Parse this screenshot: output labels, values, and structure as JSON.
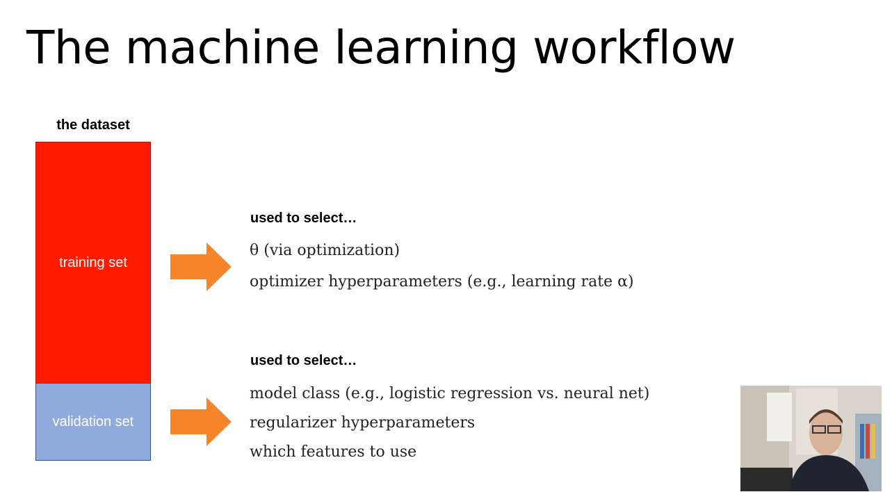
{
  "title": "The machine learning workflow",
  "dataset": {
    "label": "the dataset",
    "training_label": "training set",
    "validation_label": "validation set"
  },
  "training_section": {
    "header": "used to select…",
    "items": [
      "θ (via optimization)",
      "optimizer hyperparameters (e.g., learning rate α)"
    ]
  },
  "validation_section": {
    "header": "used to select…",
    "items": [
      "model class (e.g., logistic regression vs. neural net)",
      "regularizer hyperparameters",
      "which features to use"
    ]
  },
  "colors": {
    "training": "#ff1a00",
    "validation": "#8faadc",
    "arrow": "#f5842b"
  }
}
